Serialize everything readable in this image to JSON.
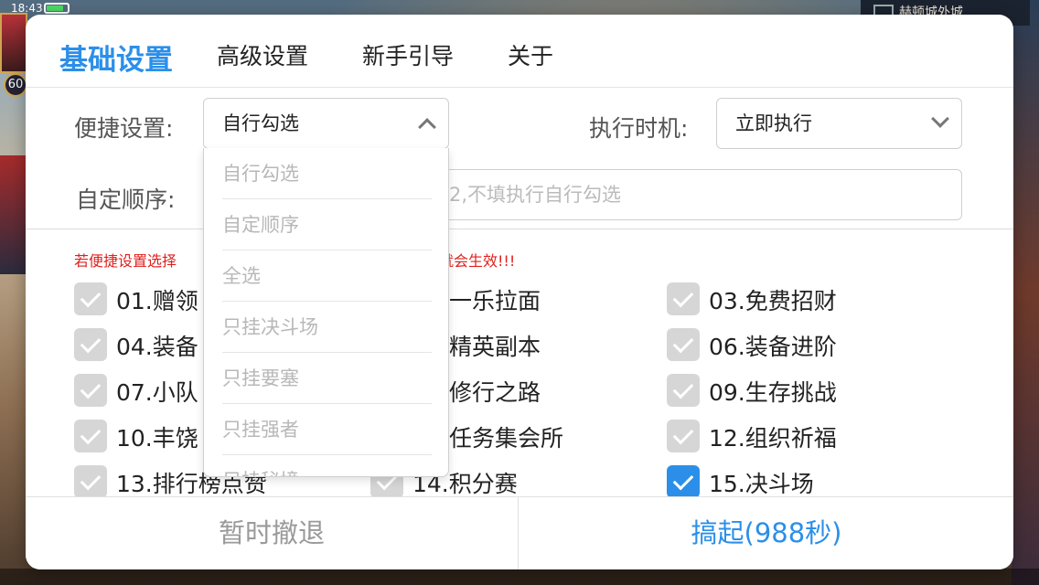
{
  "status_bar": {
    "time": "18:43"
  },
  "game": {
    "level": "60",
    "location": "赫顿城外城"
  },
  "tabs": [
    {
      "label": "基础设置",
      "active": true
    },
    {
      "label": "高级设置",
      "active": false
    },
    {
      "label": "新手引导",
      "active": false
    },
    {
      "label": "关于",
      "active": false
    }
  ],
  "quick_setting": {
    "label": "便捷设置:",
    "selected": "自行勾选"
  },
  "timing": {
    "label": "执行时机:",
    "selected": "立即执行"
  },
  "custom_order": {
    "label": "自定顺序:",
    "placeholder_visible": "2,不填执行自行勾选"
  },
  "dropdown_options": [
    "自行勾选",
    "自定顺序",
    "全选",
    "只挂决斗场",
    "只挂要塞",
    "只挂强者",
    "只挂秘境"
  ],
  "warning": {
    "left": "若便捷设置选择",
    "right": "就会生效!!!"
  },
  "tasks": [
    {
      "label": "01.赠领",
      "checked": false
    },
    {
      "label": "一乐拉面",
      "checked": false
    },
    {
      "label": "03.免费招财",
      "checked": false
    },
    {
      "label": "04.装备",
      "checked": false
    },
    {
      "label": "精英副本",
      "checked": false
    },
    {
      "label": "06.装备进阶",
      "checked": false
    },
    {
      "label": "07.小队",
      "checked": false
    },
    {
      "label": "修行之路",
      "checked": false
    },
    {
      "label": "09.生存挑战",
      "checked": false
    },
    {
      "label": "10.丰饶",
      "checked": false
    },
    {
      "label": "任务集会所",
      "checked": false
    },
    {
      "label": "12.组织祈福",
      "checked": false
    },
    {
      "label": "13.排行榜点赞",
      "checked": false
    },
    {
      "label": "14.积分赛",
      "checked": false
    },
    {
      "label": "15.决斗场",
      "checked": true
    }
  ],
  "buttons": {
    "retreat": "暂时撤退",
    "start": "搞起(988秒)"
  },
  "colors": {
    "accent": "#2b8fe9",
    "warning": "#e0201d",
    "checkbox_off": "#d6d6d6"
  }
}
